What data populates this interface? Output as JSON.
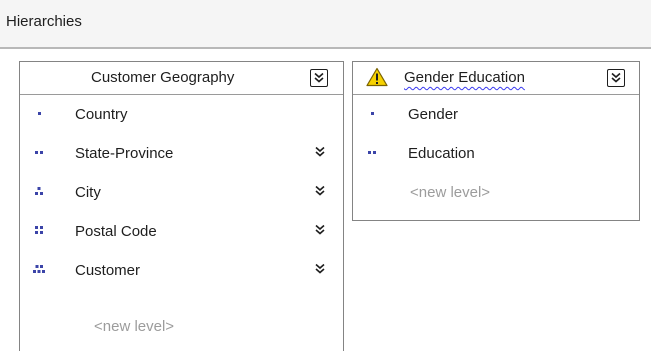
{
  "panel": {
    "title": "Hierarchies"
  },
  "hierarchies": [
    {
      "name": "Customer Geography",
      "warning": false,
      "levels": [
        {
          "label": "Country",
          "icon": "level-1-dots-icon",
          "chevron": false
        },
        {
          "label": "State-Province",
          "icon": "level-2-dots-icon",
          "chevron": true
        },
        {
          "label": "City",
          "icon": "level-3-dots-icon",
          "chevron": true
        },
        {
          "label": "Postal Code",
          "icon": "level-4-dots-icon",
          "chevron": true
        },
        {
          "label": "Customer",
          "icon": "level-5-dots-icon",
          "chevron": true
        }
      ],
      "new_level": "<new level>"
    },
    {
      "name": "Gender Education",
      "warning": true,
      "levels": [
        {
          "label": "Gender",
          "icon": "level-1-dots-icon",
          "chevron": false
        },
        {
          "label": "Education",
          "icon": "level-2-dots-icon",
          "chevron": false
        }
      ],
      "new_level": "<new level>"
    }
  ],
  "colors": {
    "level_icon": "#3b44a8",
    "warning_fill": "#f6d100",
    "wavy_underline": "#3a3af0",
    "new_level_text": "#9c9c9c"
  }
}
